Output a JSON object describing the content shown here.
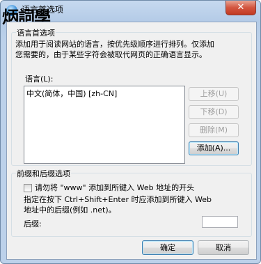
{
  "window": {
    "title": "语言首选项",
    "close_label": "✕"
  },
  "watermark": "炳詞學",
  "lang_group": {
    "label": "语言首选项",
    "description_1": "添加用于阅读网站的语言，按优先级顺序进行排列。仅添加",
    "description_2": "您需要的，由于某些字符会被取代网页的正确语言显示。",
    "list_label": "语言(L):",
    "languages": [
      "中文(简体，中国) [zh-CN]"
    ],
    "buttons": {
      "up": "上移(U)",
      "down": "下移(D)",
      "remove": "删除(M)",
      "add": "添加(A)..."
    }
  },
  "prefix_group": {
    "label": "前缀和后缀选项",
    "checkbox_label": "请勿将 \"www\" 添加到所键入 Web 地址的开头",
    "hint_1": "指定在按下 Ctrl+Shift+Enter 时应添加到所键入 Web",
    "hint_2": "地址中的后缀(例如 .net)。",
    "suffix_label": "后缀:",
    "suffix_value": ""
  },
  "footer": {
    "ok": "确定",
    "cancel": "取消"
  }
}
